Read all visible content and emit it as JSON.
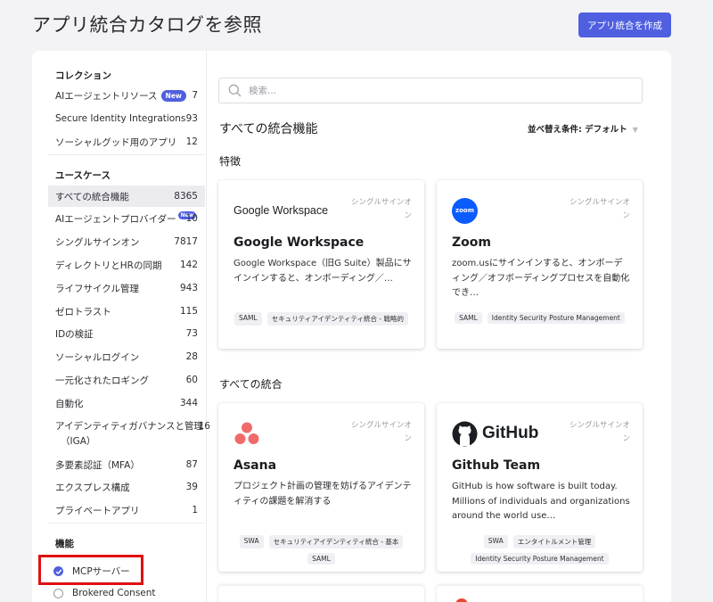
{
  "header": {
    "title": "アプリ統合カタログを参照",
    "create_button": "アプリ統合を作成"
  },
  "sidebar": {
    "collections_title": "コレクション",
    "collections": [
      {
        "label": "AIエージェントリソース",
        "badge": "New",
        "count": "7"
      },
      {
        "label": "Secure Identity Integrations",
        "count": "93"
      },
      {
        "label": "ソーシャルグッド用のアプリ",
        "count": "12"
      }
    ],
    "usecases_title": "ユースケース",
    "usecases": [
      {
        "label": "すべての統合機能",
        "count": "8365"
      },
      {
        "label": "AIエージェントプロバイダー",
        "badge": "New",
        "count": "10"
      },
      {
        "label": "シングルサインオン",
        "count": "7817"
      },
      {
        "label": "ディレクトリとHRの同期",
        "count": "142"
      },
      {
        "label": "ライフサイクル管理",
        "count": "943"
      },
      {
        "label": "ゼロトラスト",
        "count": "115"
      },
      {
        "label": "IDの検証",
        "count": "73"
      },
      {
        "label": "ソーシャルログイン",
        "count": "28"
      },
      {
        "label": "一元化されたロギング",
        "count": "60"
      },
      {
        "label": "自動化",
        "count": "344"
      },
      {
        "label": "アイデンティティガバナンスと管理",
        "label2": "（IGA）",
        "count": "16"
      },
      {
        "label": "多要素認証（MFA）",
        "count": "87"
      },
      {
        "label": "エクスプレス構成",
        "count": "39"
      },
      {
        "label": "プライベートアプリ",
        "count": "1"
      }
    ],
    "features_title": "機能",
    "features": [
      {
        "label": "MCPサーバー",
        "checked": true
      },
      {
        "label": "Brokered Consent",
        "checked": false
      }
    ]
  },
  "main": {
    "search_placeholder": "検索...",
    "heading": "すべての統合機能",
    "sort_label": "並べ替え条件: デフォルト",
    "featured_title": "特徴",
    "all_title": "すべての統合",
    "featured_cards": [
      {
        "logo_text": "Google Workspace",
        "sso": "シングルサインオン",
        "title": "Google Workspace",
        "desc": "Google Workspace（旧G Suite）製品にサインインすると、オンボーディング／…",
        "tags": [
          "SAML",
          "セキュリティアイデンティティ統合 - 戦略的"
        ]
      },
      {
        "logo_text": "zoom",
        "sso": "シングルサインオン",
        "title": "Zoom",
        "desc": "zoom.usにサインインすると、オンボーディング／オフボーディングプロセスを自動化でき…",
        "tags": [
          "SAML",
          "Identity Security Posture Management"
        ]
      }
    ],
    "all_cards": [
      {
        "sso": "シングルサインオン",
        "title": "Asana",
        "desc": "プロジェクト計画の管理を妨げるアイデンティティの課題を解消する",
        "tags": [
          "SWA",
          "セキュリティアイデンティティ統合 - 基本",
          "SAML"
        ]
      },
      {
        "logo_text": "GitHub",
        "sso": "シングルサインオン",
        "title": "Github Team",
        "desc": "GitHub is how software is built today. Millions of individuals and organizations around the world use…",
        "tags": [
          "SWA",
          "エンタイトルメント管理",
          "Identity Security Posture Management"
        ]
      }
    ]
  },
  "colors": {
    "accent": "#4f5fe0",
    "highlight": "#e01010",
    "asana": "#f06a6a",
    "zoom": "#0b5cff"
  }
}
